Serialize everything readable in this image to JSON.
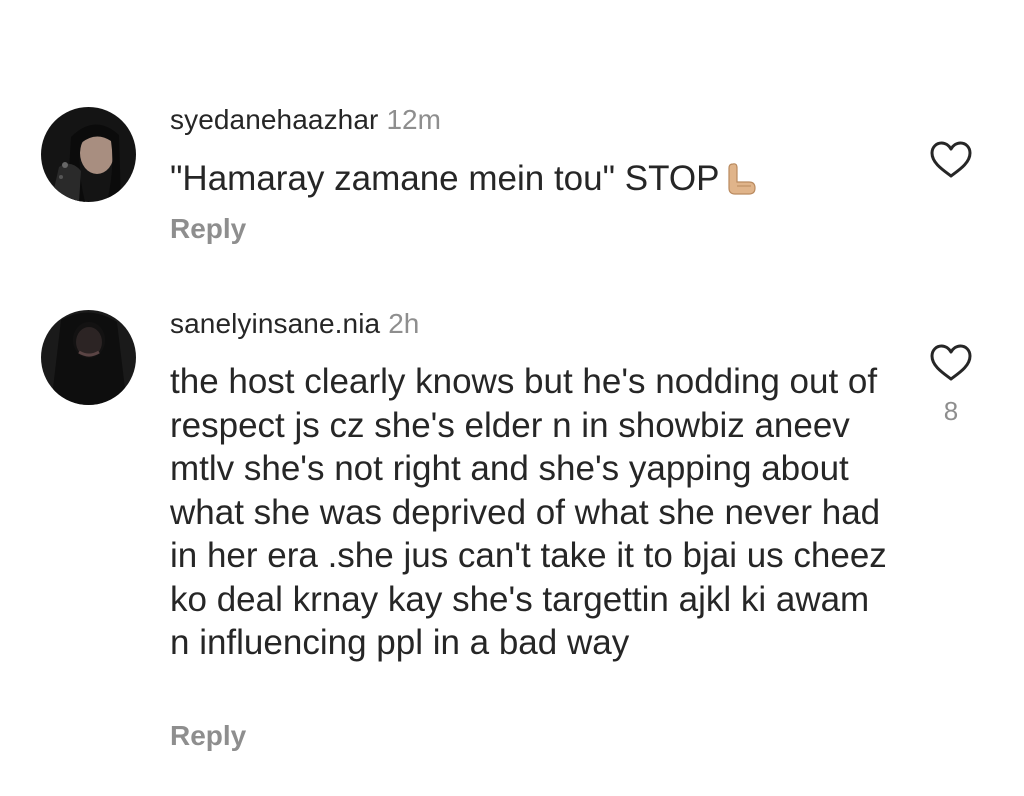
{
  "comments": [
    {
      "username": "syedanehaazhar",
      "time": "12m",
      "text": "\"Hamaray zamane mein tou\" STOP",
      "emoji": "raised-back-of-hand-emoji",
      "reply_label": "Reply",
      "likes": ""
    },
    {
      "username": "sanelyinsane.nia",
      "time": "2h",
      "text": "the host clearly knows but he's nodding out of respect js cz she's elder n in showbiz aneev mtlv she's not right and she's yapping about what she was deprived of what she never had in her era .she jus can't take it to bjai us cheez ko deal krnay kay she's targettin ajkl ki awam n influencing ppl in a bad way",
      "reply_label": "Reply",
      "likes": "8"
    }
  ],
  "colors": {
    "text": "#262626",
    "secondary": "#8e8e8e",
    "background": "#ffffff"
  }
}
